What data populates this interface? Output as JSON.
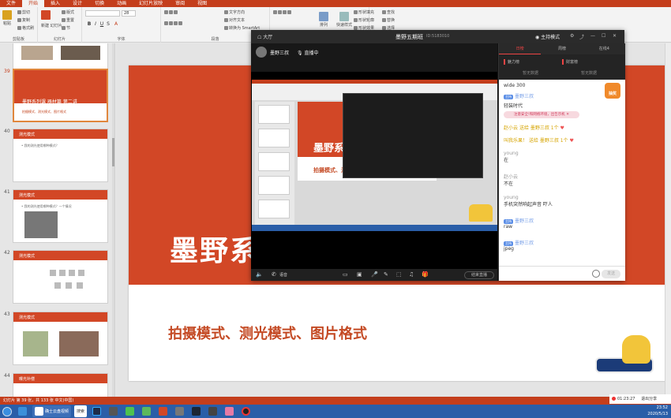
{
  "ribbon": {
    "tabs": [
      "文件",
      "开始",
      "插入",
      "设计",
      "切换",
      "动画",
      "幻灯片放映",
      "审阅",
      "视图"
    ],
    "active_tab": "开始",
    "clipboard": {
      "cut": "剪切",
      "copy": "复制",
      "format_painter": "格式刷",
      "paste": "粘贴",
      "group_label": "剪贴板"
    },
    "slides": {
      "new_slide": "新建\n幻灯片",
      "layout": "版式",
      "reset": "重置",
      "section": "节",
      "group_label": "幻灯片"
    },
    "font": {
      "size": "28",
      "group_label": "字体"
    },
    "paragraph": {
      "group_label": "段落",
      "text_direction": "文字方向",
      "align_text": "对齐文本",
      "smartart": "转换为 SmartArt"
    },
    "drawing": {
      "arrange": "排列",
      "quick_styles": "快速样式",
      "shape_fill": "形状填充",
      "shape_outline": "形状轮廓",
      "shape_effects": "形状效果"
    },
    "editing": {
      "find": "查找",
      "replace": "替换",
      "select": "选择"
    }
  },
  "slide_pane": {
    "thumbs": [
      {
        "num": "39",
        "title": "墨野系列课 器材篇 第二讲",
        "sub": "拍摄模式、测光模式、图片格式"
      },
      {
        "num": "40",
        "title": "测光模式",
        "line": "• 我的测光使用哪种模式？"
      },
      {
        "num": "41",
        "title": "测光模式",
        "line": "• 我的测光使用哪种模式？一个情况"
      },
      {
        "num": "42",
        "title": "测光模式"
      },
      {
        "num": "43",
        "title": "测光模式"
      },
      {
        "num": "44",
        "title": "曝光补偿"
      }
    ]
  },
  "slide": {
    "title": "墨野系",
    "subtitle": "拍摄模式、测光模式、图片格式"
  },
  "statusbar": {
    "left": "幻灯片 第 39 张，共 133 张    中文(中国)"
  },
  "taskbar": {
    "items": [
      "确士云盘视频",
      "搜索"
    ],
    "clock_time": "23:52",
    "clock_date": "2020/5/13"
  },
  "live": {
    "titlebar": {
      "back": "大厅",
      "title": "墨野五期班",
      "room_id": "ID:5183010",
      "mode": "主持模式"
    },
    "host": {
      "name": "墨野三叔",
      "status": "直播中"
    },
    "controls": {
      "voice": "语音",
      "end_live": "结束直播"
    },
    "nested_slide": {
      "title": "墨野系",
      "subtitle": "拍摄模式、测光模式、图片格式"
    },
    "chat": {
      "tabs": [
        "日榜",
        "周榜",
        "在线4"
      ],
      "rank": {
        "left": "魅力榜",
        "right": "财富榜",
        "left_val": "暂无数据",
        "right_val": "暂无数据"
      },
      "notice": "注意安全!和网络环境，出告示机",
      "lottery": "抽奖",
      "messages": [
        {
          "name": "",
          "text": "wide 300"
        },
        {
          "name": "",
          "text": "墨野三叔",
          "badge": "主持"
        },
        {
          "name": "",
          "text": "轻装时代"
        },
        {
          "name": "赵小云",
          "text": "送给 墨野三叔 1个"
        },
        {
          "name": "叫我乐果！",
          "text": "送给 墨野三叔 1个"
        },
        {
          "name": "young",
          "text": "在"
        },
        {
          "name": "赵小云",
          "text": "不在"
        },
        {
          "name": "young",
          "text": "手机突然响起声音 吓人"
        },
        {
          "name": "墨野三叔",
          "text": "raw",
          "badge": "主持"
        },
        {
          "name": "墨野三叔",
          "text": "jpeg",
          "badge": "主持"
        }
      ],
      "send": "发送"
    }
  },
  "recorder": {
    "time": "01:23:27",
    "exit": "退出分享"
  }
}
